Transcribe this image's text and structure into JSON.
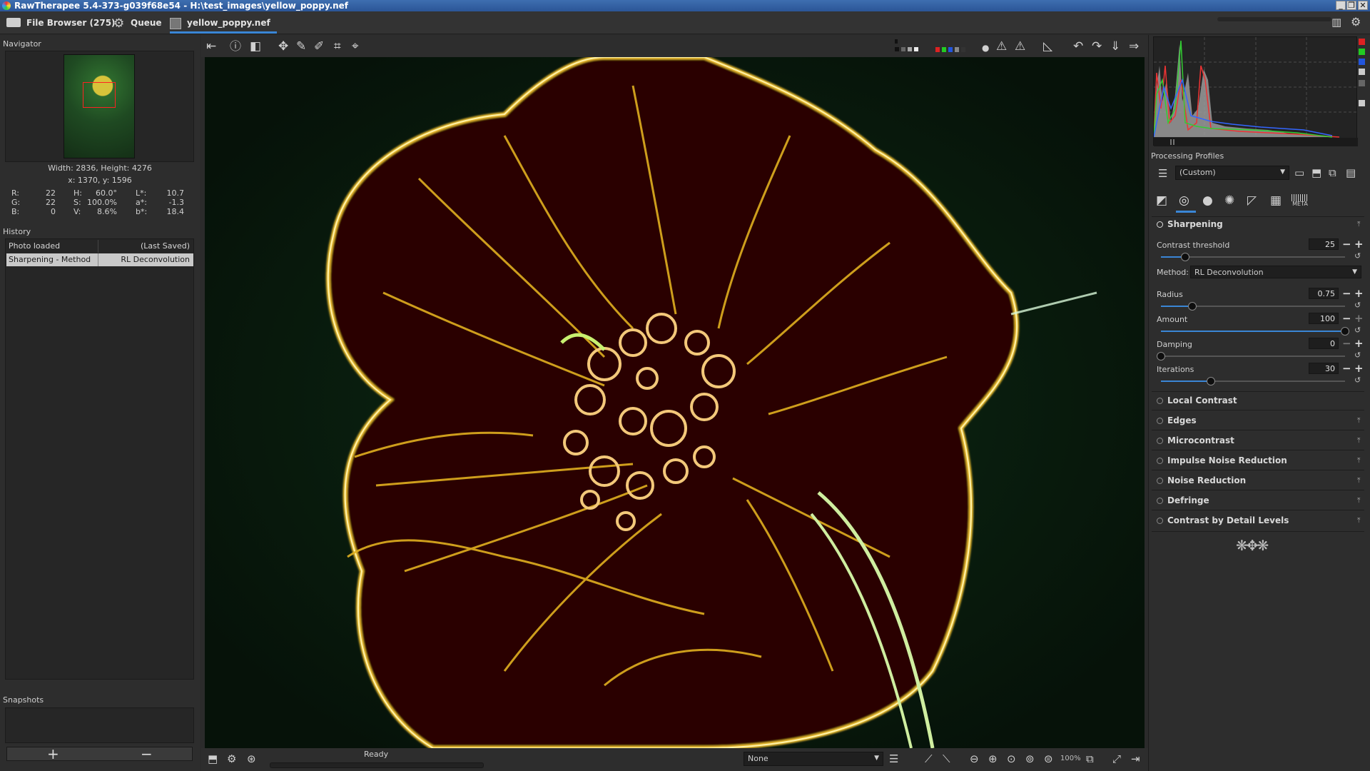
{
  "window": {
    "title": "RawTherapee 5.4-373-g039f68e54 - H:\\test_images\\yellow_poppy.nef"
  },
  "tabs": [
    {
      "label": "File Browser (275)"
    },
    {
      "label": "Queue"
    },
    {
      "label": "yellow_poppy.nef"
    }
  ],
  "navigator": {
    "title": "Navigator",
    "dimensions": "Width: 2836, Height: 4276",
    "position": "x: 1370, y: 1596",
    "readout": {
      "r_label": "R:",
      "r": "22",
      "g_label": "G:",
      "g": "22",
      "b_label": "B:",
      "b": "0",
      "h_label": "H:",
      "h": "60.0°",
      "s_label": "S:",
      "s": "100.0%",
      "v_label": "V:",
      "v": "8.6%",
      "l_label": "L*:",
      "l": "10.7",
      "a_label": "a*:",
      "a": "-1.3",
      "bs_label": "b*:",
      "bs": "18.4"
    }
  },
  "history": {
    "title": "History",
    "rows": [
      {
        "action": "Photo loaded",
        "value": "(Last Saved)"
      },
      {
        "action": "Sharpening - Method",
        "value": "RL Deconvolution"
      }
    ]
  },
  "snapshots": {
    "title": "Snapshots",
    "add": "+",
    "remove": "−"
  },
  "status": {
    "text": "Ready"
  },
  "bottom": {
    "profile_select": "None",
    "zoom_level": "100%"
  },
  "processing_profiles": {
    "title": "Processing Profiles",
    "selected": "(Custom)"
  },
  "sharpening": {
    "title": "Sharpening",
    "contrast_threshold": {
      "label": "Contrast threshold",
      "value": "25",
      "fraction": 0.13
    },
    "method": {
      "label": "Method:",
      "value": "RL Deconvolution"
    },
    "radius": {
      "label": "Radius",
      "value": "0.75",
      "fraction": 0.17
    },
    "amount": {
      "label": "Amount",
      "value": "100",
      "fraction": 1.0
    },
    "damping": {
      "label": "Damping",
      "value": "0",
      "fraction": 0.0
    },
    "iterations": {
      "label": "Iterations",
      "value": "30",
      "fraction": 0.27
    }
  },
  "collapsed_tools": [
    "Local Contrast",
    "Edges",
    "Microcontrast",
    "Impulse Noise Reduction",
    "Noise Reduction",
    "Defringe",
    "Contrast by Detail Levels"
  ],
  "tool_tabs": {
    "meta_label": "META"
  },
  "icons": {
    "window_minimize": "minimize-icon",
    "window_maximize": "maximize-icon",
    "window_close": "close-icon"
  }
}
